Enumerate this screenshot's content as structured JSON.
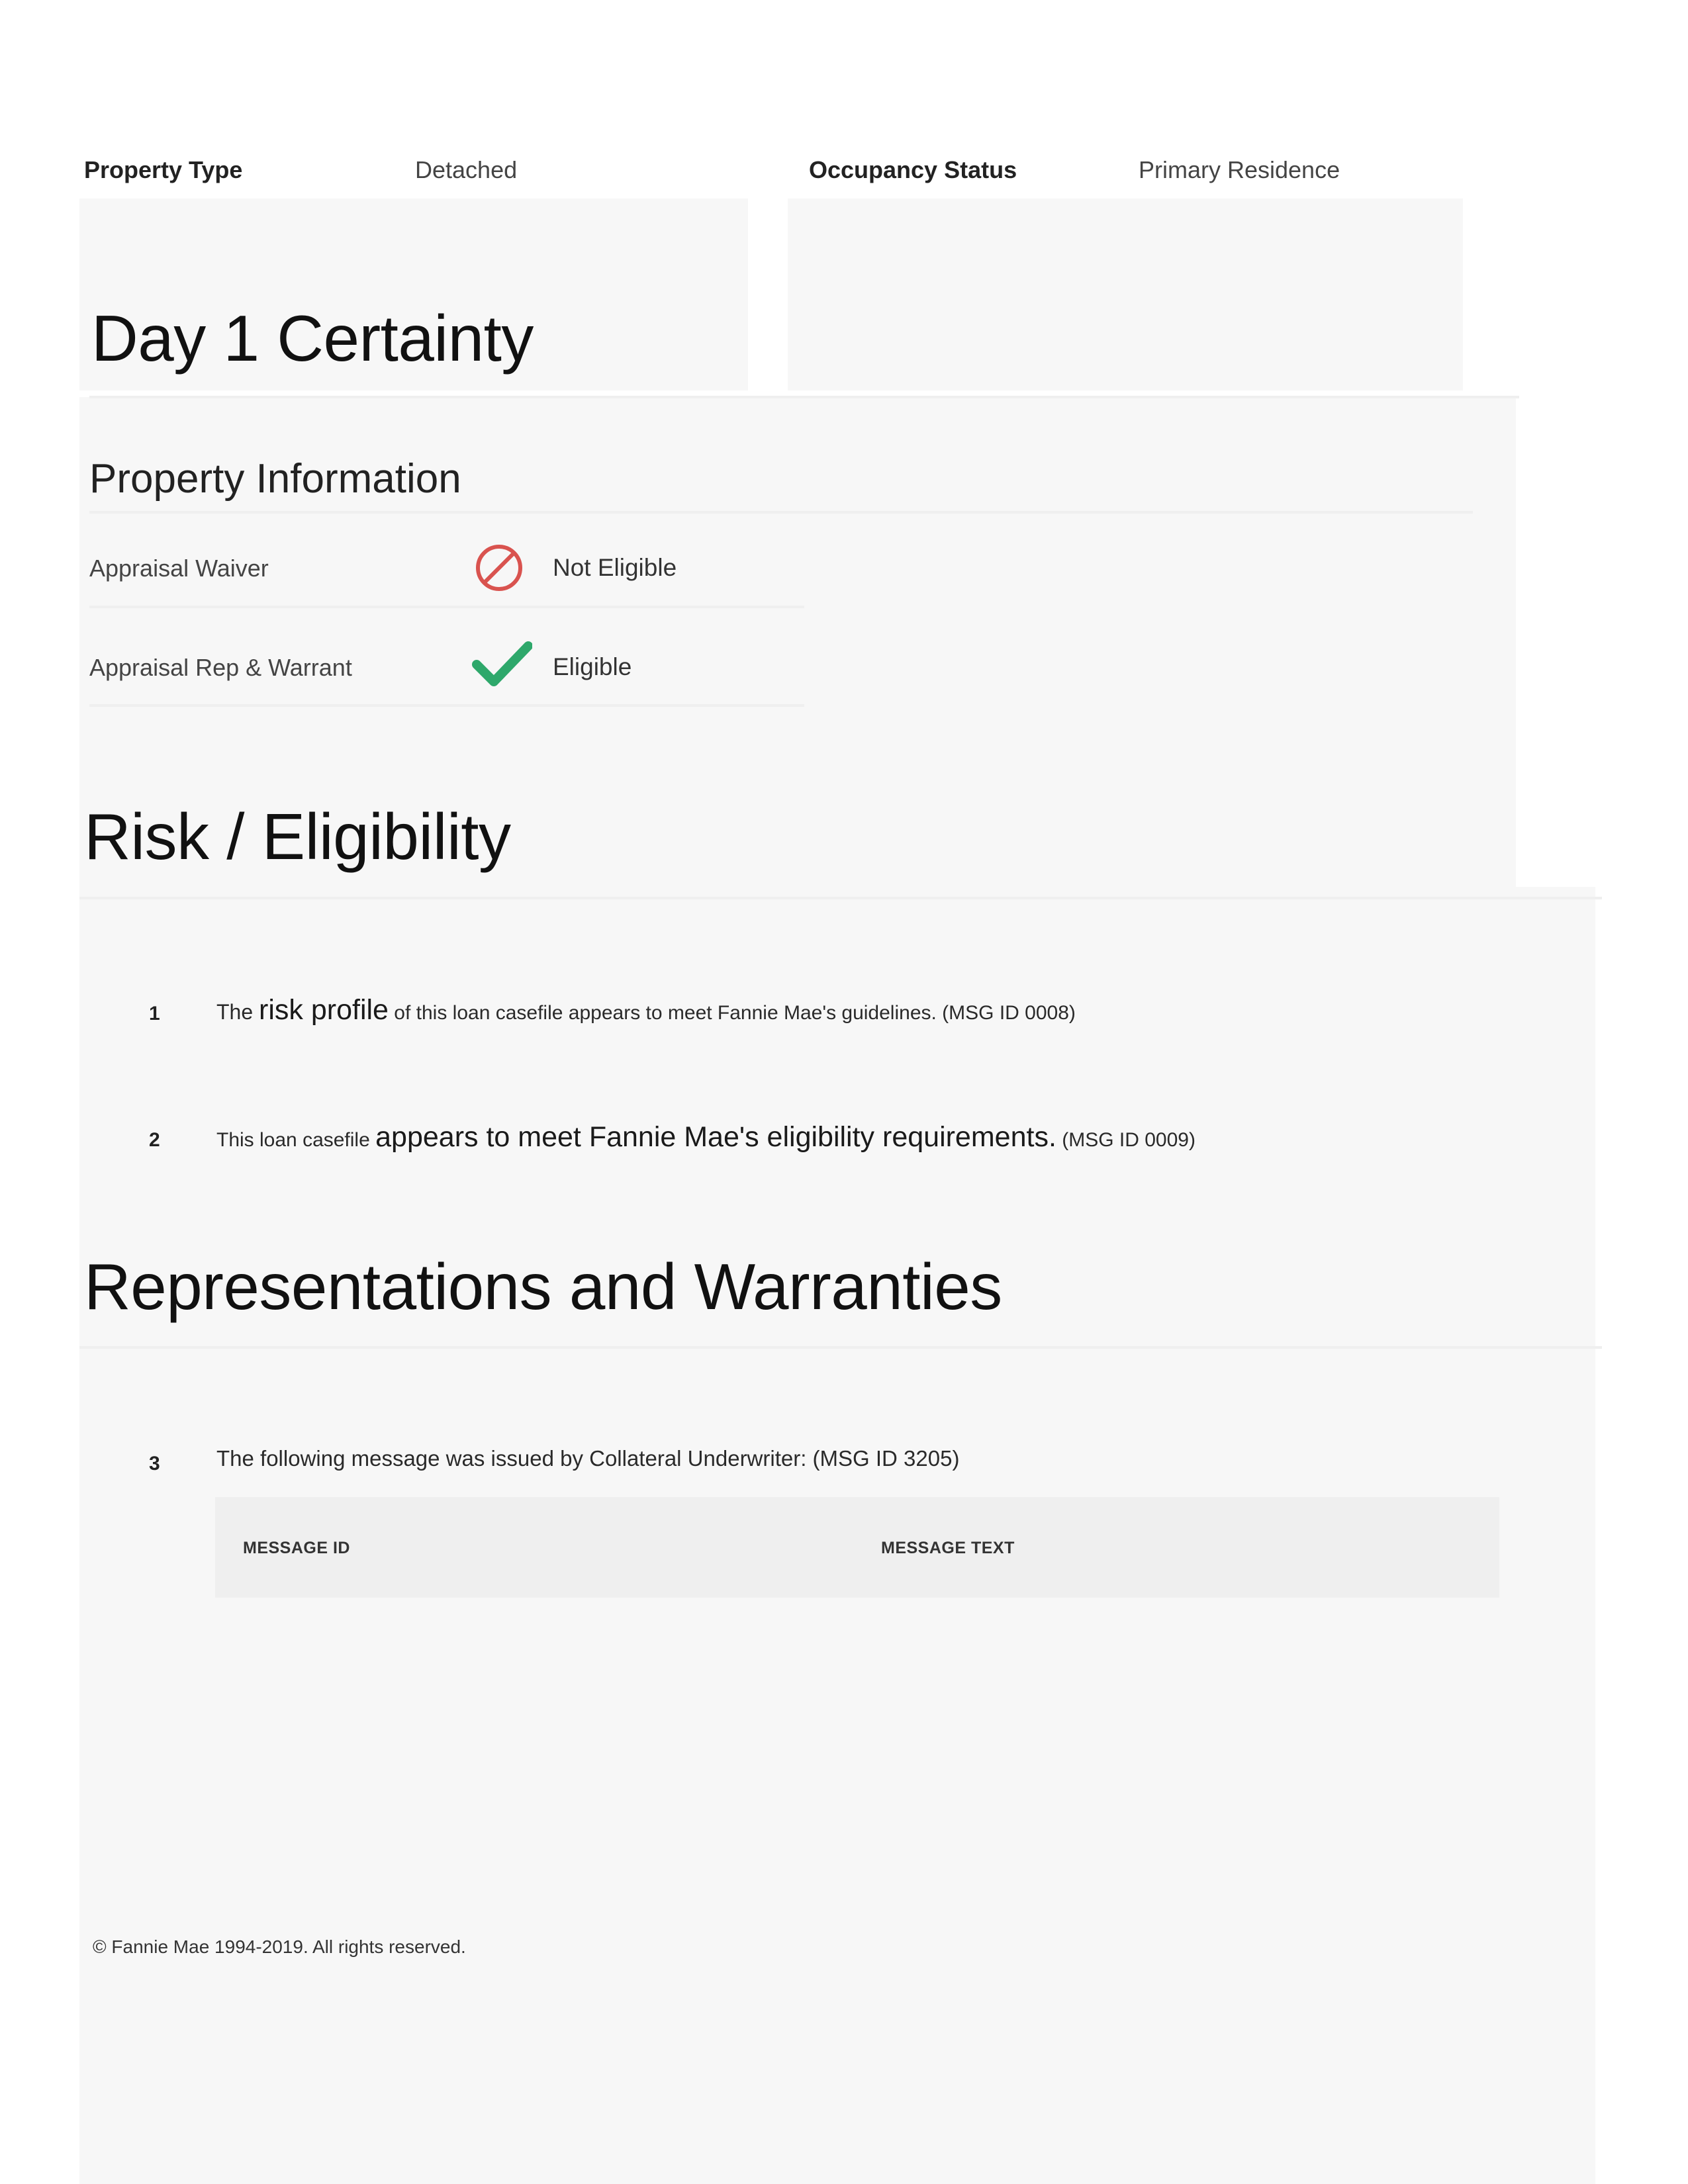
{
  "summary": {
    "property_type_label": "Property Type",
    "property_type_value": "Detached",
    "occupancy_label": "Occupancy Status",
    "occupancy_value": "Primary Residence"
  },
  "day1": {
    "title": "Day 1 Certainty",
    "property_info_title": "Property Information",
    "rows": [
      {
        "label": "Appraisal Waiver",
        "icon": "prohibited-icon",
        "icon_color": "#d9534f",
        "value": "Not Eligible"
      },
      {
        "label": "Appraisal Rep & Warrant",
        "icon": "checkmark-icon",
        "icon_color": "#2ea86b",
        "value": "Eligible"
      }
    ]
  },
  "risk": {
    "title": "Risk / Eligibility",
    "messages": [
      {
        "number": "1",
        "p1": "The ",
        "p2": "risk profile",
        "p3": " of this loan casefile appears to meet Fannie Mae's guidelines. (MSG ID 0008)"
      },
      {
        "number": "2",
        "p1": "This loan casefile ",
        "p2": "appears to meet Fannie Mae's eligibility requirements.",
        "p3": " (MSG ID 0009)"
      }
    ]
  },
  "reps": {
    "title": "Representations and Warranties",
    "message": {
      "number": "3",
      "text": "The following message was issued by Collateral Underwriter: (MSG ID 3205)"
    },
    "table_headers": [
      "MESSAGE ID",
      "MESSAGE TEXT"
    ]
  },
  "footer": {
    "copyright": "© Fannie Mae 1994-2019. All rights reserved."
  },
  "colors": {
    "panel_bg": "#f7f7f7",
    "prohibited": "#d9534f",
    "check": "#2ea86b"
  }
}
